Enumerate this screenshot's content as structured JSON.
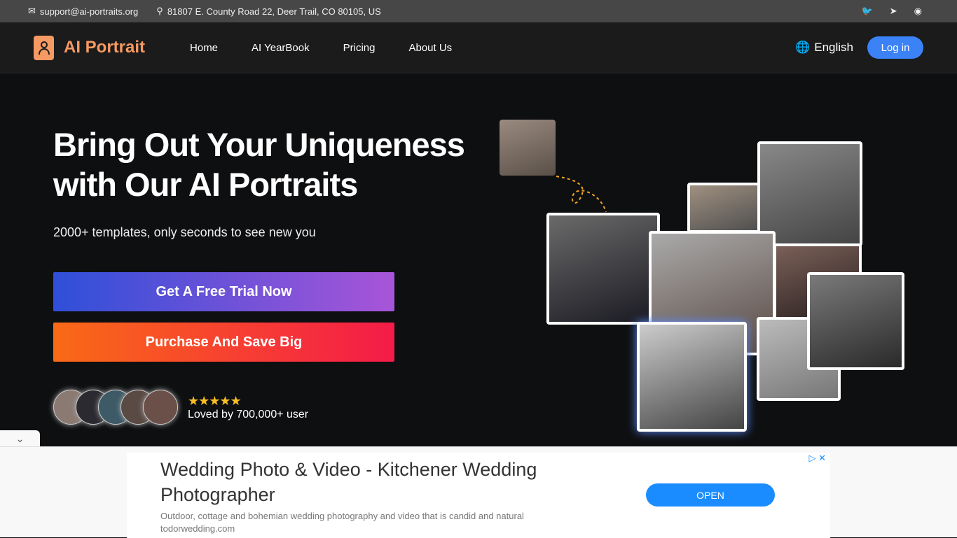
{
  "topbar": {
    "email": "support@ai-portraits.org",
    "address": "81807 E. County Road 22, Deer Trail, CO 80105, US",
    "social": [
      "twitter-icon",
      "telegram-icon",
      "discord-icon"
    ]
  },
  "nav": {
    "brand": "AI Portrait",
    "items": [
      "Home",
      "AI YearBook",
      "Pricing",
      "About Us"
    ],
    "language": "English",
    "login": "Log in"
  },
  "hero": {
    "title_line1": "Bring Out Your Uniqueness",
    "title_line2": "with Our AI Portraits",
    "subtitle": "2000+ templates, only seconds to see new you",
    "cta_primary": "Get A Free Trial Now",
    "cta_secondary": "Purchase And Save Big",
    "stars": "★★★★★",
    "rating": 5,
    "loved": "Loved by 700,000+ user"
  },
  "ad": {
    "title": "Wedding Photo & Video - Kitchener Wedding Photographer",
    "description": "Outdoor, cottage and bohemian wedding photography and video that is candid and natural",
    "domain": "todorwedding.com",
    "button": "OPEN"
  },
  "colors": {
    "brand": "#f59a62",
    "login": "#3b82f6",
    "open": "#1a8cff"
  }
}
